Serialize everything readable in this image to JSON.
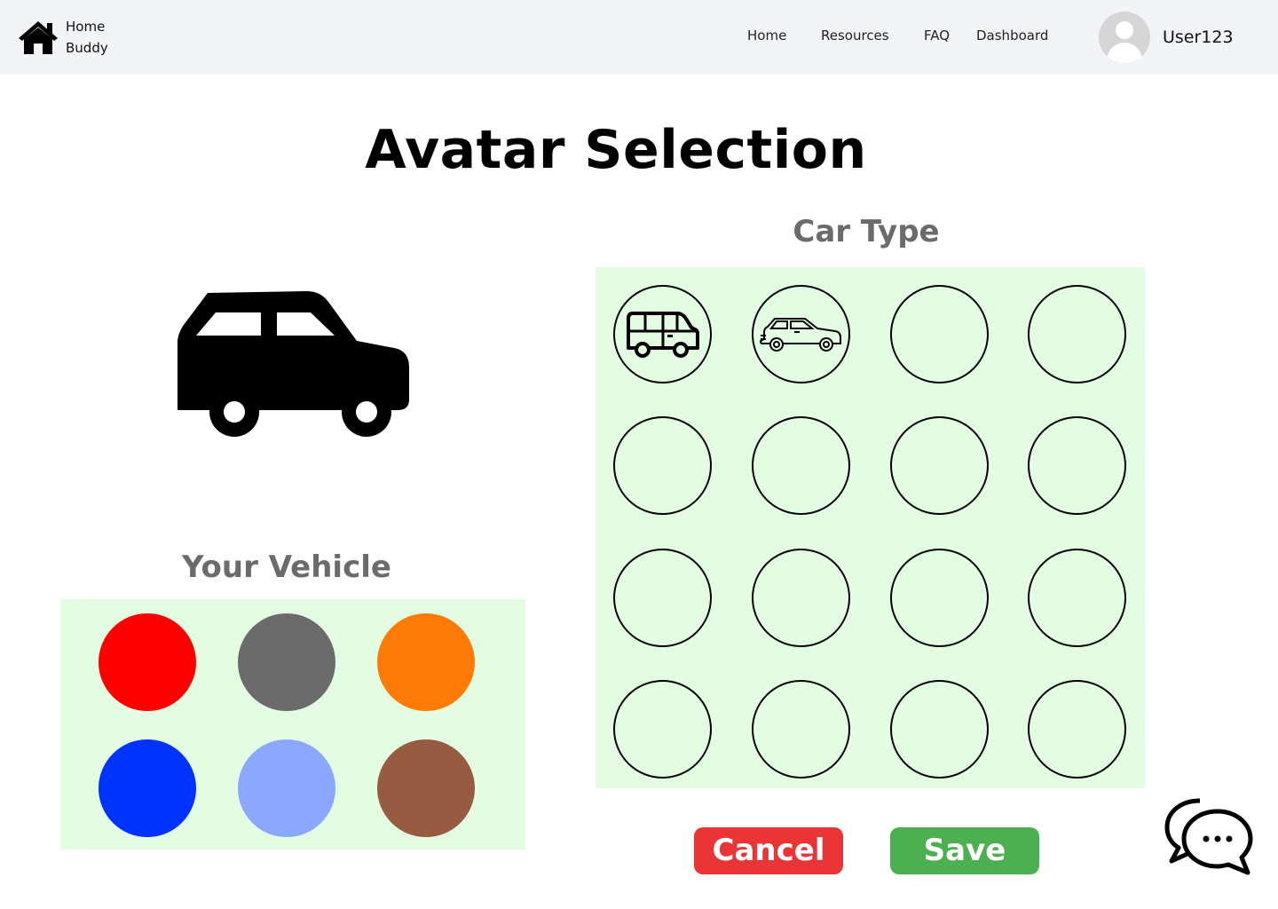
{
  "brand": {
    "line1": "Home",
    "line2": "Buddy",
    "icon": "house-icon"
  },
  "nav": {
    "home": "Home",
    "resources": "Resources",
    "faq": "FAQ",
    "dashboard": "Dashboard"
  },
  "user": {
    "name": "User123",
    "icon": "user-avatar-icon"
  },
  "page": {
    "title": "Avatar Selection"
  },
  "preview": {
    "icon": "car-icon",
    "color": "#000000"
  },
  "vehicle_section": {
    "title": "Your Vehicle",
    "colors": [
      {
        "name": "red",
        "hex": "#ff0000"
      },
      {
        "name": "gray",
        "hex": "#6b6b6b"
      },
      {
        "name": "orange",
        "hex": "#ff7b07"
      },
      {
        "name": "blue",
        "hex": "#0033ff"
      },
      {
        "name": "light-blue",
        "hex": "#8ba7ff"
      },
      {
        "name": "brown",
        "hex": "#975b42"
      }
    ],
    "panel_color": "#e3fde3"
  },
  "car_type_section": {
    "title": "Car Type",
    "slots": [
      {
        "icon": "van-icon"
      },
      {
        "icon": "suv-icon"
      },
      {
        "icon": ""
      },
      {
        "icon": ""
      },
      {
        "icon": ""
      },
      {
        "icon": ""
      },
      {
        "icon": ""
      },
      {
        "icon": ""
      },
      {
        "icon": ""
      },
      {
        "icon": ""
      },
      {
        "icon": ""
      },
      {
        "icon": ""
      },
      {
        "icon": ""
      },
      {
        "icon": ""
      },
      {
        "icon": ""
      },
      {
        "icon": ""
      }
    ]
  },
  "actions": {
    "cancel": {
      "label": "Cancel",
      "color": "#e93535"
    },
    "save": {
      "label": "Save",
      "color": "#4caf50"
    }
  },
  "chat": {
    "icon": "chat-bubbles-icon"
  }
}
